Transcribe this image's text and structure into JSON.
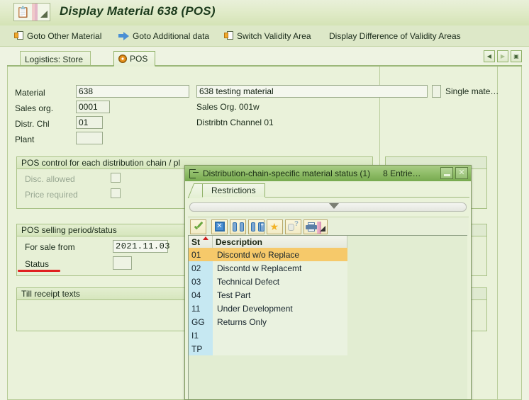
{
  "window": {
    "title": "Display Material 638 (POS)",
    "sysmenu_icon": "sap-system-menu-icon"
  },
  "menubar": {
    "items": [
      {
        "label": "Goto Other Material",
        "icon": "document-arrow-icon"
      },
      {
        "label": "Goto Additional data",
        "icon": "blue-right-arrow-icon"
      },
      {
        "label": "Switch Validity Area",
        "icon": "document-arrow-icon"
      },
      {
        "label": "Display Difference of Validity Areas",
        "icon": ""
      }
    ]
  },
  "tabs": {
    "items": [
      {
        "label": "Logistics: Store",
        "active": false,
        "icon": ""
      },
      {
        "label": "POS",
        "active": true,
        "icon": "radio-orange-icon"
      }
    ],
    "nav": {
      "prev": "◀",
      "next": "▶",
      "list": "▣"
    }
  },
  "form": {
    "material": {
      "label": "Material",
      "value": "638",
      "description": "638 testing material",
      "type_label": "Single mate…"
    },
    "sales_org": {
      "label": "Sales org.",
      "value": "0001",
      "description": "Sales Org. 001w"
    },
    "distr_chl": {
      "label": "Distr. Chl",
      "value": "01",
      "description": "Distribtn Channel 01"
    },
    "plant": {
      "label": "Plant",
      "value": ""
    }
  },
  "groups": {
    "pos_control": {
      "title": "POS control for each distribution chain / pl",
      "fields": [
        {
          "label": "Disc. allowed",
          "checked": false,
          "disabled": true
        },
        {
          "label": "Price required",
          "checked": false,
          "disabled": true
        }
      ]
    },
    "pos_selling": {
      "title": "POS selling period/status",
      "fields": [
        {
          "label": "For sale from",
          "value": "2021.11.03"
        },
        {
          "label": "Status",
          "value": ""
        }
      ]
    },
    "till_receipt": {
      "title": "Till receipt texts"
    }
  },
  "dialog": {
    "title": "Distribution-chain-specific material status (1)",
    "entries_label": "8 Entrie…",
    "title_icon": "dialog-window-icon",
    "minimize_label": "—",
    "close_label": "✕",
    "tab_label": "Restrictions",
    "toolbar": [
      {
        "name": "check-icon",
        "title": "Continue"
      },
      {
        "name": "cancel-x-icon",
        "title": "Cancel"
      },
      {
        "name": "find-binoculars-icon",
        "title": "Find"
      },
      {
        "name": "find-next-binoculars-icon",
        "title": "Find next"
      },
      {
        "name": "star-favorite-icon",
        "title": "Personal value list"
      },
      {
        "name": "hand-help-icon",
        "title": "Help"
      },
      {
        "name": "print-icon",
        "title": "Print"
      }
    ],
    "table": {
      "columns": [
        "St",
        "Description"
      ],
      "rows": [
        {
          "st": "01",
          "description": "Discontd w/o Replace",
          "selected": true
        },
        {
          "st": "02",
          "description": "Discontd w Replacemt",
          "selected": false
        },
        {
          "st": "03",
          "description": "Technical Defect",
          "selected": false
        },
        {
          "st": "04",
          "description": "Test Part",
          "selected": false
        },
        {
          "st": "11",
          "description": "Under Development",
          "selected": false
        },
        {
          "st": "GG",
          "description": "Returns Only",
          "selected": false
        },
        {
          "st": "I1",
          "description": "",
          "selected": false
        },
        {
          "st": "TP",
          "description": "",
          "selected": false
        }
      ]
    }
  },
  "colors": {
    "app_background": "#eaf2da",
    "title_bar": "#dfeac6",
    "dialog_title": "#8fbd68",
    "selected_row": "#f6c96a",
    "key_column": "#c6e8f2",
    "annotation": "#e02020"
  }
}
